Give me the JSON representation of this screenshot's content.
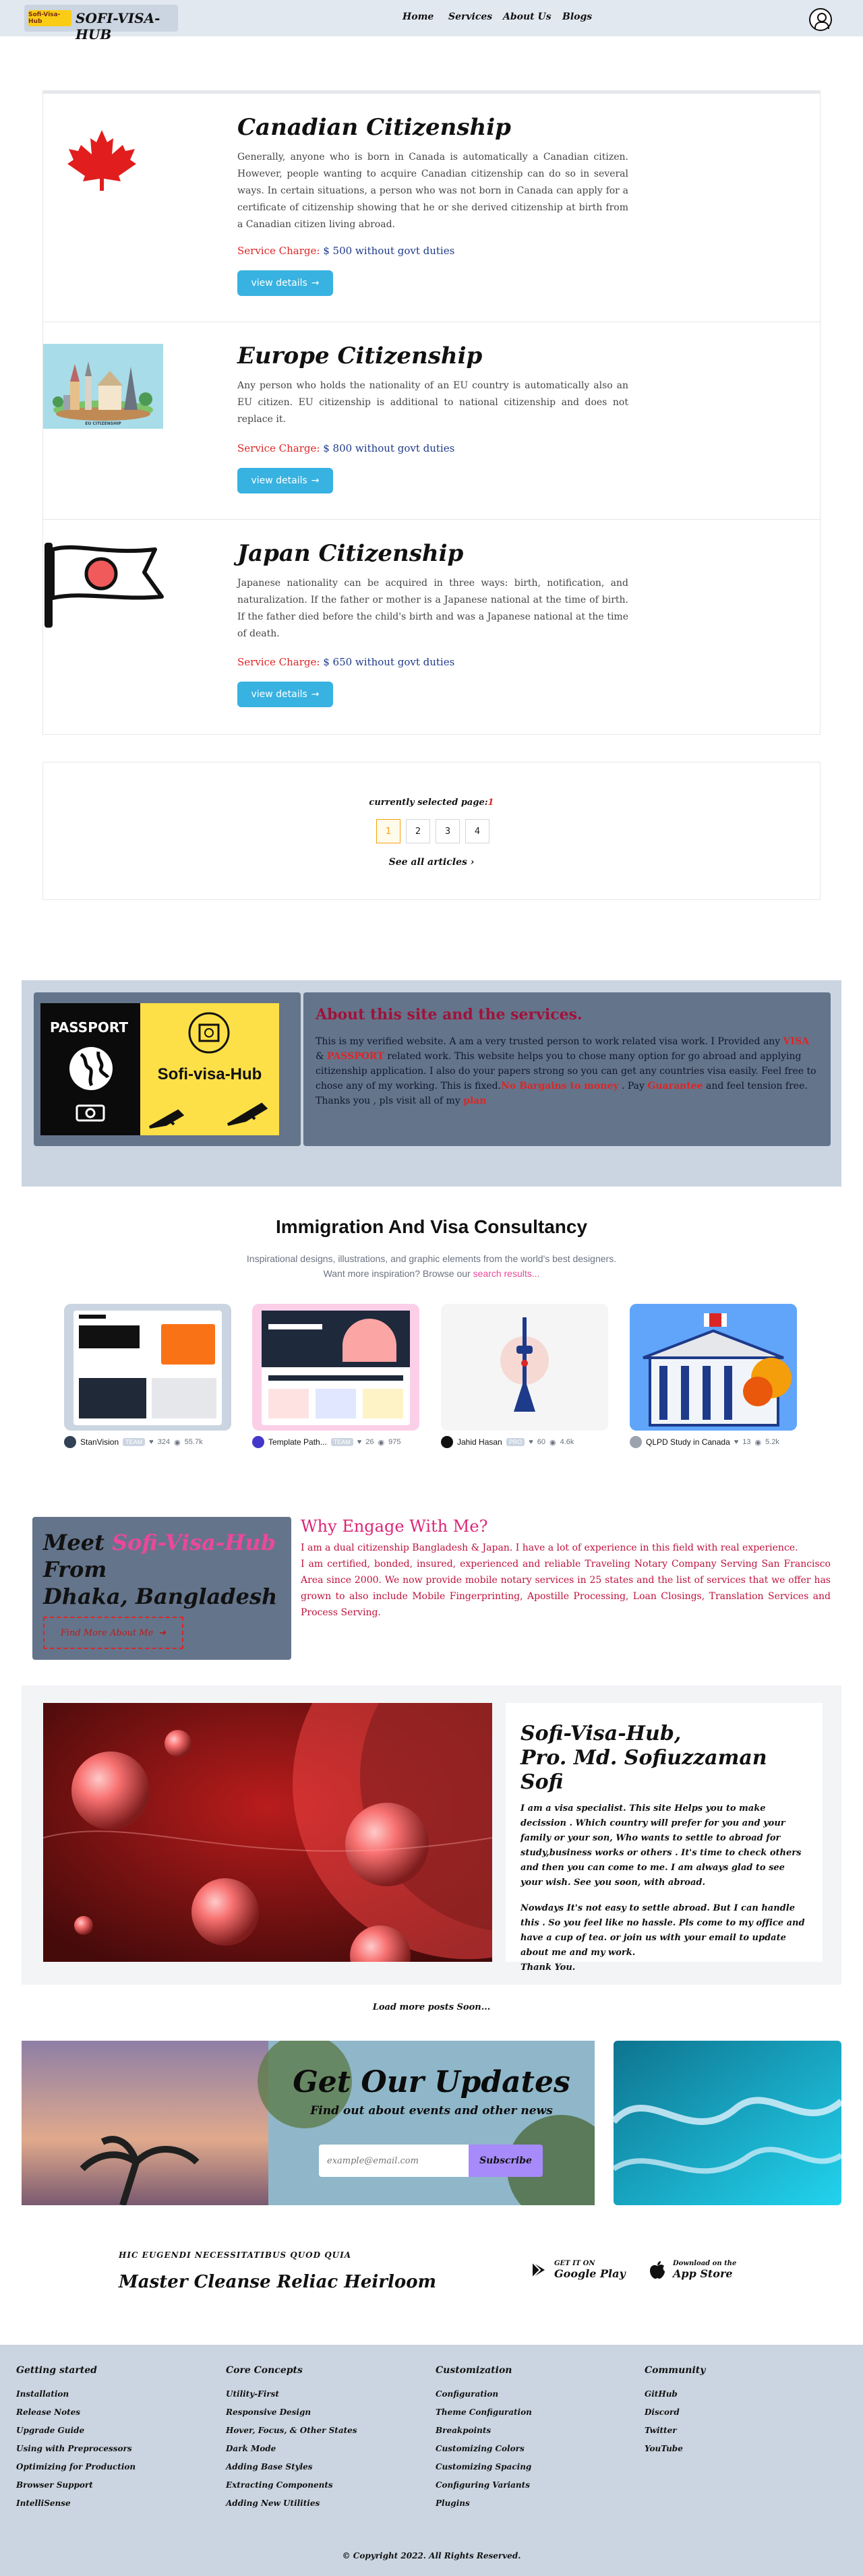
{
  "header": {
    "logo_badge": "Sofi-Visa-Hub",
    "logo_text": "SOFI-VISA-HUB",
    "nav": [
      "Home",
      "Services",
      "About Us",
      "Blogs"
    ]
  },
  "cards": [
    {
      "title": "Canadian Citizenship",
      "desc": "Generally, anyone who is born in Canada is automatically a Canadian citizen. However, people wanting to acquire Canadian citizenship can do so in several ways. In certain situations, a person who was not born in Canada can apply for a certificate of citizenship showing that he or she derived citizenship at birth from a Canadian citizen living abroad.",
      "charge_label": "Service Charge:",
      "charge_value": "$ 500 without govt duties",
      "button": "view details"
    },
    {
      "title": "Europe Citizenship",
      "desc": "Any person who holds the nationality of an EU country is automatically also an EU citizen. EU citizenship is additional to national citizenship and does not replace it.",
      "charge_label": "Service Charge:",
      "charge_value": "$ 800 without govt duties",
      "button": "view details",
      "img_caption": "EU CITIZENSHIP"
    },
    {
      "title": "Japan Citizenship",
      "desc": "Japanese nationality can be acquired in three ways: birth, notification, and naturalization. If the father or mother is a Japanese national at the time of birth. If the father died before the child's birth and was a Japanese national at the time of death.",
      "charge_label": "Service Charge:",
      "charge_value": "$ 650 without govt duties",
      "button": "view details"
    }
  ],
  "pagination": {
    "label": "currently selected page:",
    "current": "1",
    "pages": [
      "1",
      "2",
      "3",
      "4"
    ],
    "see_all": "See all articles"
  },
  "about": {
    "passport_word": "PASSPORT",
    "brand": "Sofi-visa-Hub",
    "title": "About this site and the services.",
    "p1": "This is my verified website. A am a very trusted person to work related visa work. I Provided any ",
    "visa": "VISA",
    "amp": " & ",
    "passport": "PASSPORT",
    "p2": " related work. This website helps you to chose many option for go abroad and applying citizenship application. I also do your papers strong so you can get any countries visa easily. Feel free to chose any of my working. This is fixed.",
    "nobargain": "No Bargains to money",
    "p3": " . Pay ",
    "guarantee": "Guarantee",
    "p4": " and feel tension free. Thanks you , pls visit all of my ",
    "plan": "plan"
  },
  "immigration": {
    "title": "Immigration And Visa Consultancy",
    "sub1": "Inspirational designs, illustrations, and graphic elements from the world's best designers.",
    "sub2": "Want more inspiration? Browse our ",
    "sub_link": "search results...",
    "shots": [
      {
        "author": "StanVision",
        "tag": "TEAM",
        "likes": "324",
        "views": "55.7k"
      },
      {
        "author": "Template Path...",
        "tag": "TEAM",
        "likes": "26",
        "views": "975"
      },
      {
        "author": "Jahid Hasan",
        "tag": "PRO",
        "likes": "60",
        "views": "4.6k"
      },
      {
        "author": "QLPD Study in Canada",
        "tag": "",
        "likes": "13",
        "views": "5.2k"
      }
    ]
  },
  "meet": {
    "l1": "Meet ",
    "brand": "Sofi-Visa-Hub",
    "l2": "From",
    "l3": "Dhaka, Bangladesh",
    "button": "Find More About Me"
  },
  "why": {
    "title": "Why Engage With Me?",
    "p1": "I am a dual citizenship Bangladesh & Japan. I have a lot of experience in this field with real experience.",
    "p2": "I am certified, bonded, insured, experienced and reliable Traveling Notary Company Serving San Francisco Area since 2000. We now provide mobile notary services in 25 states and the list of services that we offer has grown to also include Mobile Fingerprinting, Apostille Processing, Loan Closings, Translation Services and Process Serving."
  },
  "profile": {
    "title1": "Sofi-Visa-Hub,",
    "title2": "Pro. Md. Sofiuzzaman Sofi",
    "p1": "I am a visa specialist. This site Helps you to make decission . Which country will prefer for you and your family or your son, Who wants to settle to abroad for study,business works or others . It's time to check others and then you can come to me. I am always glad to see your wish. See you soon, with abroad.",
    "p2": "Nowdays It's not easy to settle abroad. But I can handle this . So you feel like no hassle. Pls come to my office and have a cup of tea. or join us with your email to update about me and my work.",
    "p3": "Thank You.",
    "load_more": "Load more posts Soon..."
  },
  "updates": {
    "title": "Get Our Updates",
    "sub": "Find out about events and other news",
    "placeholder": "example@email.com",
    "button": "Subscribe"
  },
  "apps": {
    "kicker": "HIC EUGENDI NECESSITATIBUS QUOD QUIA",
    "tagline": "Master Cleanse Reliac Heirloom",
    "google_small": "GET IT ON",
    "google_big": "Google Play",
    "apple_small": "Download on the",
    "apple_big": "App Store"
  },
  "footer": {
    "cols": [
      {
        "title": "Getting started",
        "links": [
          "Installation",
          "Release Notes",
          "Upgrade Guide",
          "Using with Preprocessors",
          "Optimizing for Production",
          "Browser Support",
          "IntelliSense"
        ]
      },
      {
        "title": "Core Concepts",
        "links": [
          "Utility-First",
          "Responsive Design",
          "Hover, Focus, & Other States",
          "Dark Mode",
          "Adding Base Styles",
          "Extracting Components",
          "Adding New Utilities"
        ]
      },
      {
        "title": "Customization",
        "links": [
          "Configuration",
          "Theme Configuration",
          "Breakpoints",
          "Customizing Colors",
          "Customizing Spacing",
          "Configuring Variants",
          "Plugins"
        ]
      },
      {
        "title": "Community",
        "links": [
          "GitHub",
          "Discord",
          "Twitter",
          "YouTube"
        ]
      }
    ],
    "copyright": "© Copyright 2022. All Rights Reserved."
  }
}
